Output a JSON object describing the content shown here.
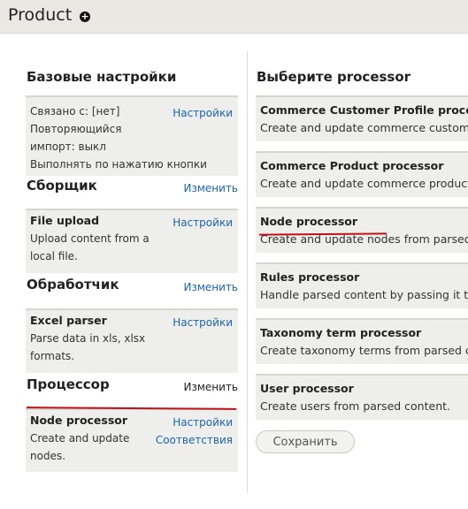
{
  "page": {
    "title": "Product"
  },
  "left": {
    "basic": {
      "title": "Базовые настройки",
      "settings_link": "Настройки",
      "lines": [
        "Связано с: [нет]",
        "Повторяющийся",
        "импорт: выкл",
        "Выполнять по нажатию кнопки"
      ]
    },
    "fetcher": {
      "title": "Сборщик",
      "change_link": "Изменить",
      "name": "File upload",
      "settings_link": "Настройки",
      "desc": [
        "Upload content from a",
        "local file."
      ]
    },
    "parser": {
      "title": "Обработчик",
      "change_link": "Изменить",
      "name": "Excel parser",
      "settings_link": "Настройки",
      "desc": [
        "Parse data in xls, xlsx",
        "formats."
      ]
    },
    "processor": {
      "title": "Процессор",
      "change_link": "Изменить",
      "name": "Node processor",
      "settings_link": "Настройки",
      "mapping_link": "Соответствия",
      "desc": [
        "Create and update",
        "nodes."
      ]
    }
  },
  "right": {
    "title": "Выберите processor",
    "processors": [
      {
        "name": "Commerce Customer Profile processor",
        "desc": "Create and update commerce customer profiles."
      },
      {
        "name": "Commerce Product processor",
        "desc": "Create and update commerce products."
      },
      {
        "name": "Node processor",
        "desc": "Create and update nodes from parsed content."
      },
      {
        "name": "Rules processor",
        "desc": "Handle parsed content by passing it to rules."
      },
      {
        "name": "Taxonomy term processor",
        "desc": "Create taxonomy terms from parsed content."
      },
      {
        "name": "User processor",
        "desc": "Create users from parsed content."
      }
    ],
    "save_label": "Сохранить"
  },
  "colors": {
    "link": "#1a65b0",
    "annotation": "#c0121c",
    "panel": "#eeeeec"
  }
}
